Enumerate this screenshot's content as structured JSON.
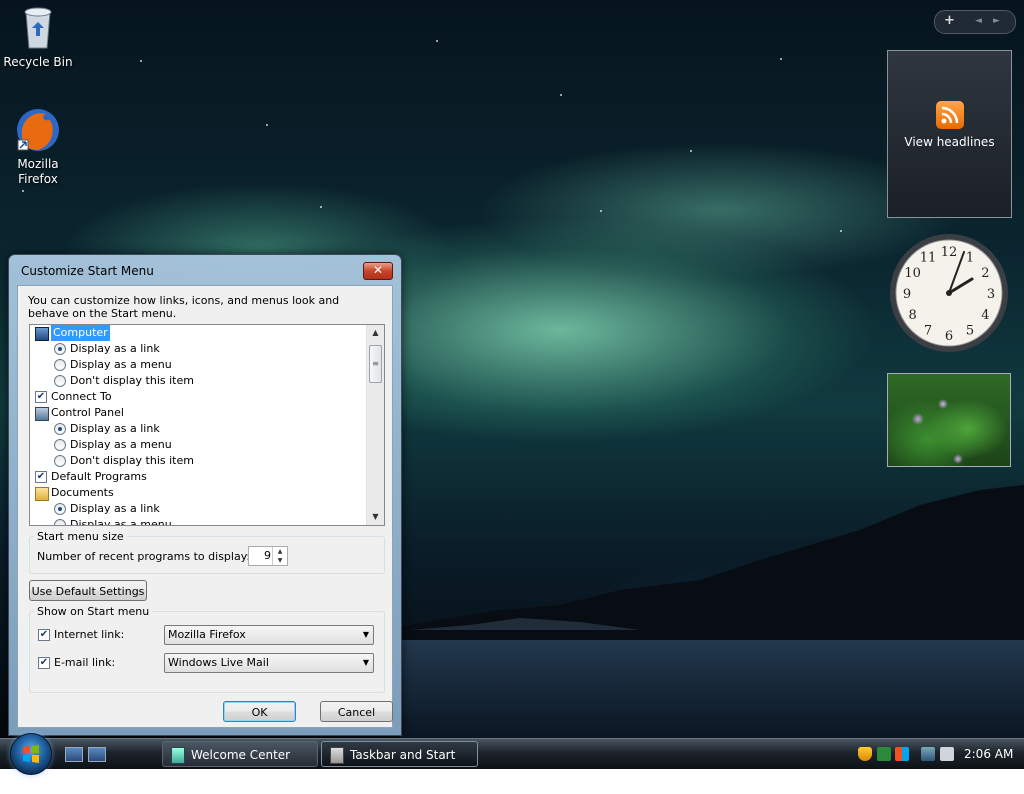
{
  "desktop": {
    "icons": [
      {
        "label": "Recycle Bin"
      },
      {
        "label": "Mozilla Firefox"
      }
    ],
    "gadgets": {
      "feed_label": "View headlines",
      "clock_numbers": [
        "12",
        "1",
        "2",
        "3",
        "4",
        "5",
        "6",
        "7",
        "8",
        "9",
        "10",
        "11"
      ],
      "clock_time": "2:06",
      "toolbar_add": "+",
      "toolbar_prev": "◄",
      "toolbar_next": "►"
    }
  },
  "dialog": {
    "title": "Customize Start Menu",
    "close_label": "✕",
    "intro": "You can customize how links, icons, and menus look and behave on the Start menu.",
    "list": [
      {
        "kind": "header",
        "icon": "computer-icon",
        "label": "Computer",
        "selected": true
      },
      {
        "kind": "radio",
        "label": "Display as a link",
        "checked": true
      },
      {
        "kind": "radio",
        "label": "Display as a menu",
        "checked": false
      },
      {
        "kind": "radio",
        "label": "Don't display this item",
        "checked": false
      },
      {
        "kind": "check",
        "label": "Connect To",
        "checked": true
      },
      {
        "kind": "header",
        "icon": "control-panel-icon",
        "label": "Control Panel",
        "selected": false
      },
      {
        "kind": "radio",
        "label": "Display as a link",
        "checked": true
      },
      {
        "kind": "radio",
        "label": "Display as a menu",
        "checked": false
      },
      {
        "kind": "radio",
        "label": "Don't display this item",
        "checked": false
      },
      {
        "kind": "check",
        "label": "Default Programs",
        "checked": true
      },
      {
        "kind": "header",
        "icon": "documents-icon",
        "label": "Documents",
        "selected": false
      },
      {
        "kind": "radio",
        "label": "Display as a link",
        "checked": true
      },
      {
        "kind": "radio",
        "label": "Display as a menu",
        "checked": false
      }
    ],
    "start_menu_size": {
      "legend": "Start menu size",
      "recent_label": "Number of recent programs to display:",
      "recent_value": "9"
    },
    "use_default_label": "Use Default Settings",
    "show_on_start": {
      "legend": "Show on Start menu",
      "internet_label": "Internet link:",
      "internet_checked": true,
      "internet_value": "Mozilla Firefox",
      "email_label": "E-mail link:",
      "email_checked": true,
      "email_value": "Windows Live Mail"
    },
    "ok_label": "OK",
    "cancel_label": "Cancel"
  },
  "taskbar": {
    "tasks": [
      {
        "label": "Welcome Center",
        "active": false
      },
      {
        "label": "Taskbar and Start M...",
        "active": true
      }
    ],
    "clock": "2:06 AM"
  },
  "colors": {
    "selection": "#3399ff",
    "dialog_frame": "#a9c4dc",
    "rss_orange": "#f08a24"
  }
}
